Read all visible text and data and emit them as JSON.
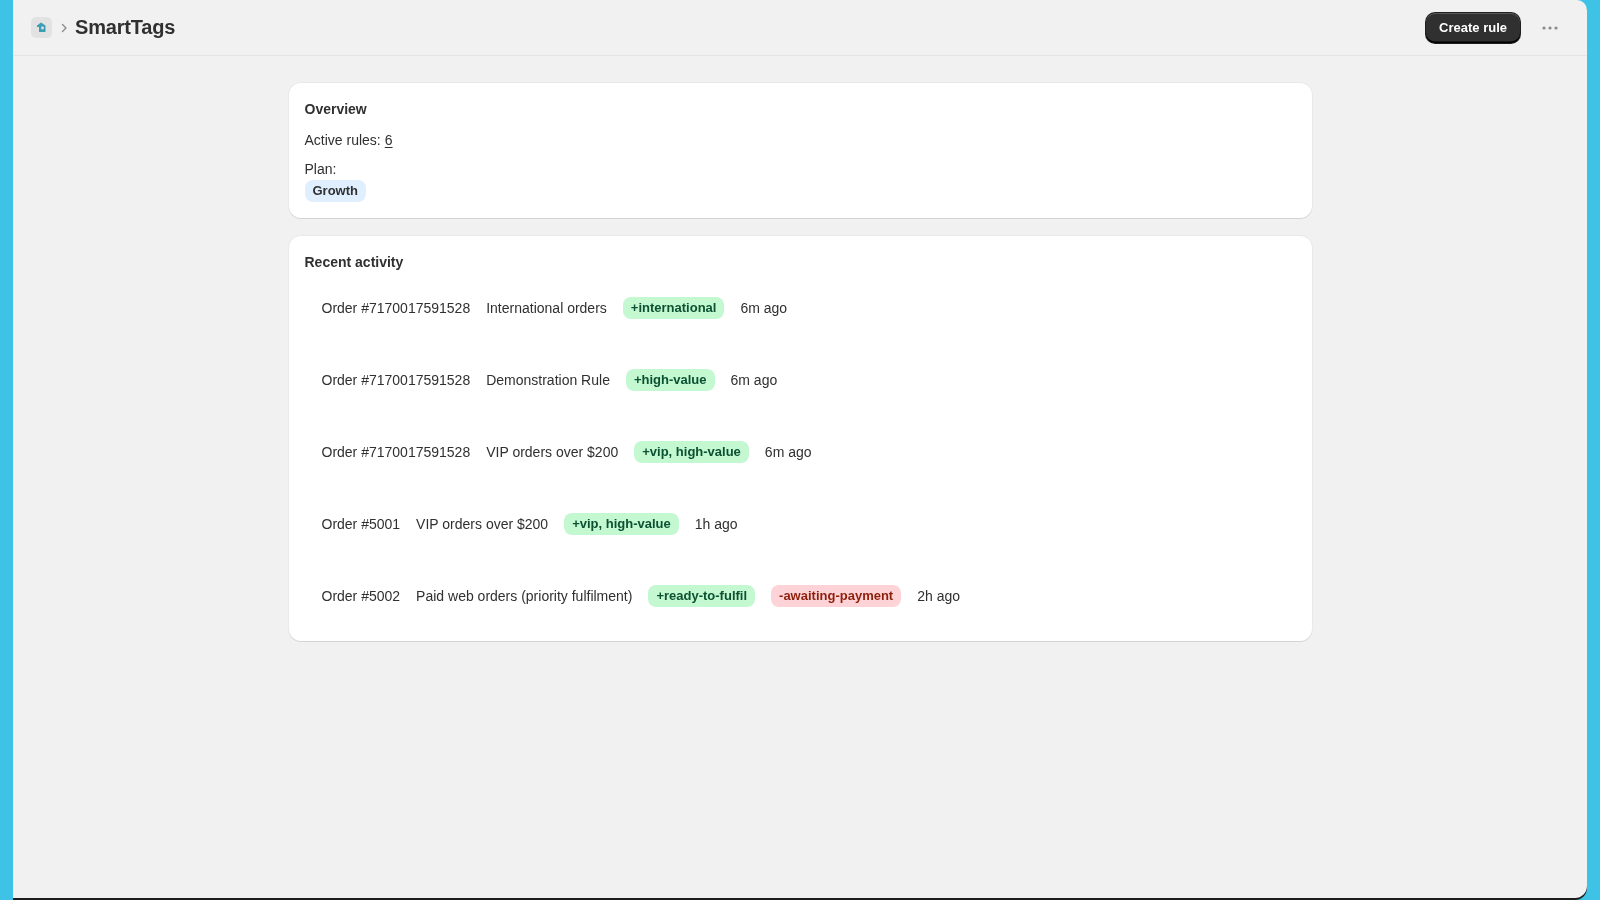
{
  "header": {
    "app_name": "SmartTags",
    "primary_action": "Create rule"
  },
  "overview": {
    "title": "Overview",
    "active_rules_label": "Active rules:",
    "active_rules_count": "6",
    "plan_label": "Plan:",
    "plan": "Growth"
  },
  "recent_activity": {
    "title": "Recent activity",
    "rows": [
      {
        "order": "Order #7170017591528",
        "rule": "International orders",
        "tags": [
          {
            "kind": "added",
            "label": "+international"
          }
        ],
        "time": "6m ago"
      },
      {
        "order": "Order #7170017591528",
        "rule": "Demonstration Rule",
        "tags": [
          {
            "kind": "added",
            "label": "+high-value"
          }
        ],
        "time": "6m ago"
      },
      {
        "order": "Order #7170017591528",
        "rule": "VIP orders over $200",
        "tags": [
          {
            "kind": "added",
            "label": "+vip, high-value"
          }
        ],
        "time": "6m ago"
      },
      {
        "order": "Order #5001",
        "rule": "VIP orders over $200",
        "tags": [
          {
            "kind": "added",
            "label": "+vip, high-value"
          }
        ],
        "time": "1h ago"
      },
      {
        "order": "Order #5002",
        "rule": "Paid web orders (priority fulfilment)",
        "tags": [
          {
            "kind": "added",
            "label": "+ready-to-fulfil"
          },
          {
            "kind": "removed",
            "label": "-awaiting-payment"
          }
        ],
        "time": "2h ago"
      }
    ]
  }
}
